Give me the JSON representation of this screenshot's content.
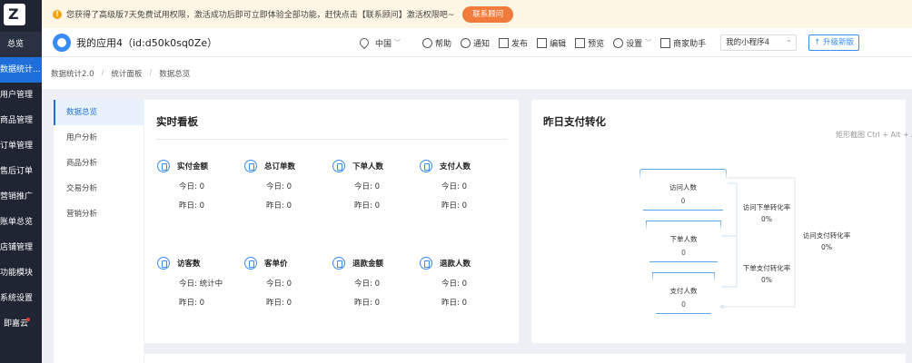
{
  "sidebar": {
    "items": [
      {
        "label": "总览"
      },
      {
        "label": "数据统计..."
      },
      {
        "label": "用户管理"
      },
      {
        "label": "商品管理"
      },
      {
        "label": "订单管理"
      },
      {
        "label": "售后订单"
      },
      {
        "label": "营销推广"
      },
      {
        "label": "账单总览"
      },
      {
        "label": "店铺管理"
      },
      {
        "label": "功能模块"
      },
      {
        "label": "系统设置"
      },
      {
        "label": "即嘉云"
      }
    ]
  },
  "notice": {
    "text": "您获得了高级版7天免费试用权限，激活成功后即可立即体验全部功能，赶快点击【联系顾问】激活权限吧~",
    "button": "联系顾问"
  },
  "header": {
    "app_name": "我的应用4（id:d50k0sq0Ze）",
    "region": "中国",
    "help": "帮助",
    "notify": "通知",
    "publish": "发布",
    "edit": "编辑",
    "preview": "预览",
    "settings": "设置",
    "assistant": "商家助手",
    "mini_program": "我的小程序4",
    "upgrade": "↑ 升级新版"
  },
  "breadcrumb": [
    "数据统计2.0",
    "统计面板",
    "数据总览"
  ],
  "subnav": [
    "数据总览",
    "用户分析",
    "商品分析",
    "交易分析",
    "营销分析"
  ],
  "realtime": {
    "title": "实时看板",
    "metrics": [
      {
        "label": "实付金额",
        "today": "今日: 0",
        "yesterday": "昨日: 0"
      },
      {
        "label": "总订单数",
        "today": "今日: 0",
        "yesterday": "昨日: 0"
      },
      {
        "label": "下单人数",
        "today": "今日: 0",
        "yesterday": "昨日: 0"
      },
      {
        "label": "支付人数",
        "today": "今日: 0",
        "yesterday": "昨日: 0"
      },
      {
        "label": "访客数",
        "today": "今日: 统计中",
        "yesterday": "昨日: 0"
      },
      {
        "label": "客单价",
        "today": "今日: 0",
        "yesterday": "昨日: 0"
      },
      {
        "label": "退款金额",
        "today": "今日: 0",
        "yesterday": "昨日: 0"
      },
      {
        "label": "退款人数",
        "today": "今日: 0",
        "yesterday": "昨日: 0"
      }
    ]
  },
  "conversion": {
    "title": "昨日支付转化",
    "stages": [
      {
        "label": "访问人数",
        "value": "0"
      },
      {
        "label": "下单人数",
        "value": "0"
      },
      {
        "label": "支付人数",
        "value": "0"
      }
    ],
    "rates": [
      {
        "label": "访问下单转化率",
        "value": "0%"
      },
      {
        "label": "下单支付转化率",
        "value": "0%"
      },
      {
        "label": "访问支付转化率",
        "value": "0%"
      }
    ]
  },
  "watermark": "矩形截图 Ctrl + Alt + A",
  "colors": {
    "accent": "#1e6fd9",
    "sidebar": "#1f2533",
    "notice_button": "#f07b3a"
  }
}
